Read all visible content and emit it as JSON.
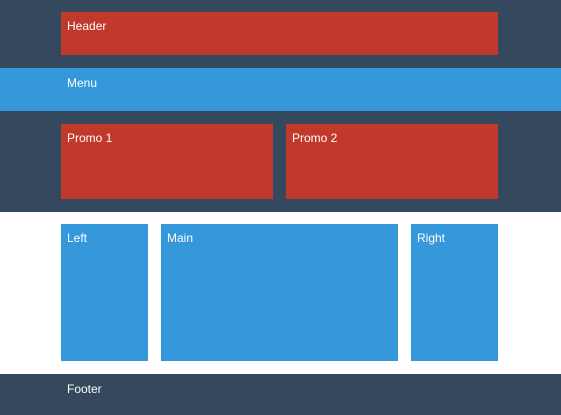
{
  "colors": {
    "dark": "#34495e",
    "red": "#c0392b",
    "blue": "#3498db",
    "white": "#ffffff"
  },
  "header": {
    "label": "Header"
  },
  "menu": {
    "label": "Menu"
  },
  "promos": [
    {
      "label": "Promo 1"
    },
    {
      "label": "Promo 2"
    }
  ],
  "content": {
    "left": {
      "label": "Left"
    },
    "main": {
      "label": "Main"
    },
    "right": {
      "label": "Right"
    }
  },
  "footer": {
    "label": "Footer"
  }
}
